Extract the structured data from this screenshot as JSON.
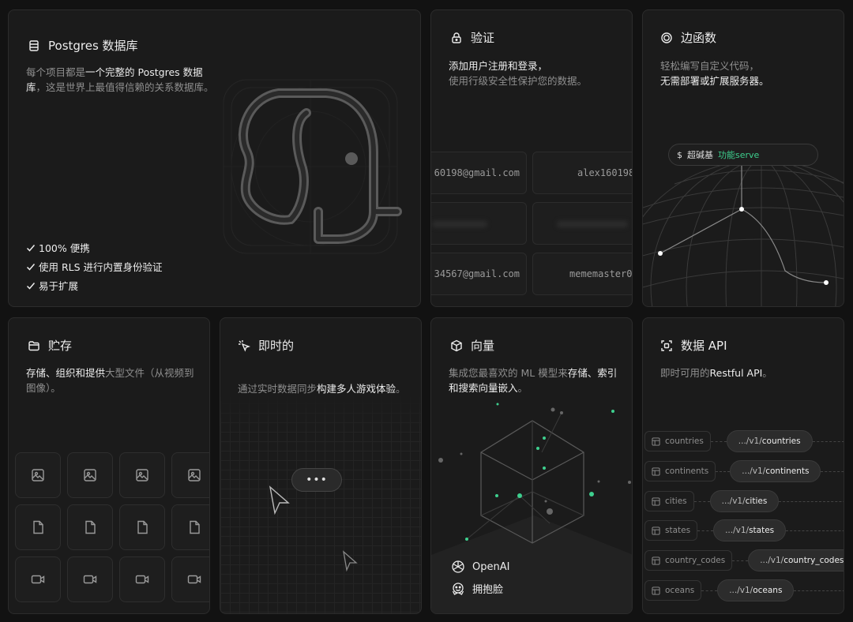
{
  "postgres": {
    "title": "Postgres 数据库",
    "desc_pre": "每个项目都是",
    "desc_em": "一个完整的 Postgres 数据库",
    "desc_post": "，这是世界上最值得信赖的关系数据库。",
    "features": [
      "100% 便携",
      "使用 RLS 进行内置身份验证",
      "易于扩展"
    ]
  },
  "auth": {
    "title": "验证",
    "desc_line1": "添加用户注册和登录，",
    "desc_line2": "使用行级安全性保护您的数据。",
    "emails": [
      "60198@gmail.com",
      "alex160198",
      "34567@gmail.com",
      "mememaster0"
    ]
  },
  "edge": {
    "title": "边函数",
    "desc_line1": "轻松编写自定义代码，",
    "desc_line2": "无需部署或扩展服务器。",
    "cmd_prefix": "$",
    "cmd_text": "超碱基",
    "cmd_accent": "功能serve"
  },
  "storage": {
    "title": "贮存",
    "desc_em": "存储、组织和提供",
    "desc_post": "大型文件（从视频到图像）。"
  },
  "realtime": {
    "title": "即时的",
    "desc_pre": "通过实时数据同步",
    "desc_em": "构建多人游戏体验",
    "desc_post": "。",
    "bubble": "•••"
  },
  "vector": {
    "title": "向量",
    "desc_pre": "集成您最喜欢的 ML 模型来",
    "desc_em1": "存储、索引和搜索向量嵌入",
    "desc_post": "。",
    "providers": [
      "OpenAI",
      "拥抱脸"
    ]
  },
  "api": {
    "title": "数据 API",
    "desc_pre": "即时可用的",
    "desc_em": "Restful API",
    "desc_post": "。",
    "rows": [
      {
        "table": "countries",
        "prefix": ".../v1/",
        "endpoint": "countries"
      },
      {
        "table": "continents",
        "prefix": ".../v1/",
        "endpoint": "continents"
      },
      {
        "table": "cities",
        "prefix": ".../v1/",
        "endpoint": "cities"
      },
      {
        "table": "states",
        "prefix": ".../v1/",
        "endpoint": "states"
      },
      {
        "table": "country_codes",
        "prefix": ".../v1/",
        "endpoint": "country_codes"
      },
      {
        "table": "oceans",
        "prefix": ".../v1/",
        "endpoint": "oceans"
      }
    ]
  },
  "colors": {
    "accent": "#3ecf8e",
    "card_bg": "#1b1b1b",
    "border": "#2c2c2c"
  }
}
